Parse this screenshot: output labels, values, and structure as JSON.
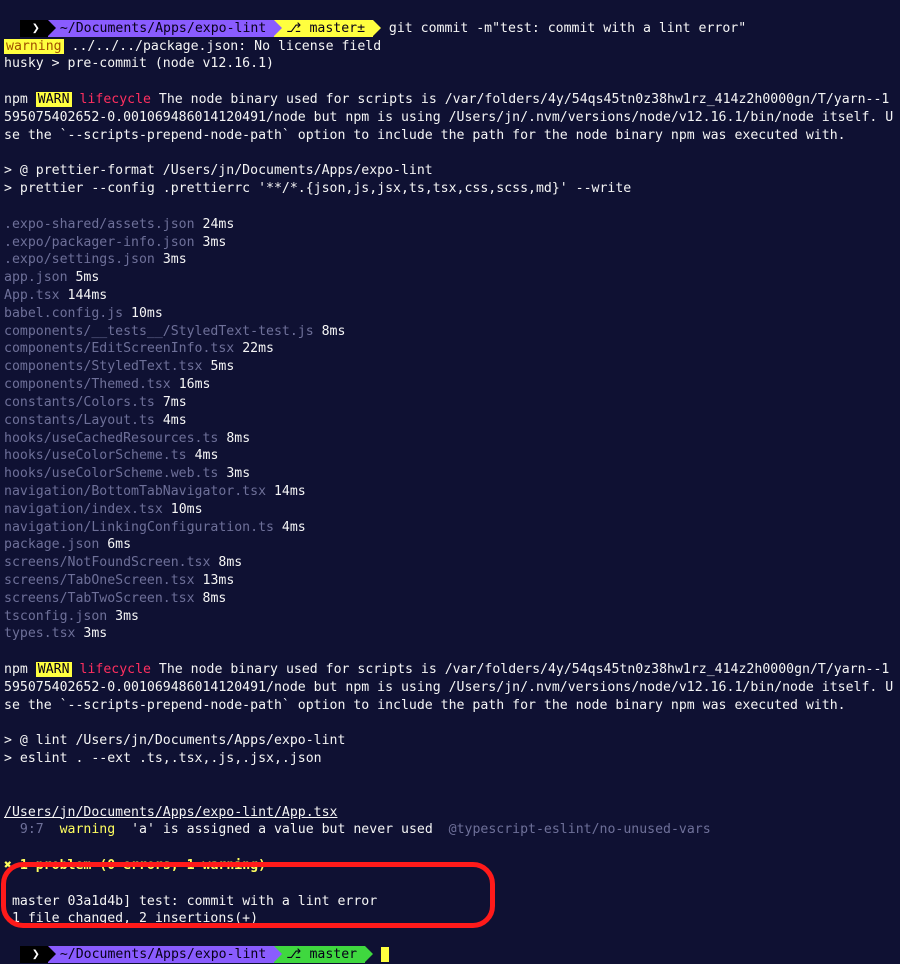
{
  "prompt1": {
    "chevron": "❯",
    "path": "~/Documents/Apps/expo-lint",
    "branch_icon": "⎇",
    "branch": "master±",
    "command": "git commit -m\"test: commit with a lint error\""
  },
  "warning_line": {
    "prefix": "warning",
    "text": " ../../../package.json: No license field"
  },
  "husky": "husky > pre-commit (node v12.16.1)",
  "npm_warn": {
    "npm": "npm",
    "warn": "WARN",
    "lifecycle": "lifecycle",
    "msg": " The node binary used for scripts is /var/folders/4y/54qs45tn0z38hw1rz_414z2h0000gn/T/yarn--1595075402652-0.001069486014120491/node but npm is using /Users/jn/.nvm/versions/node/v12.16.1/bin/node itself. Use the `--scripts-prepend-node-path` option to include the path for the node binary npm was executed with."
  },
  "prettier_hdr": "> @ prettier-format /Users/jn/Documents/Apps/expo-lint",
  "prettier_cmd": "> prettier --config .prettierrc '**/*.{json,js,jsx,ts,tsx,css,scss,md}' --write",
  "files": [
    {
      "name": ".expo-shared/assets.json",
      "time": "24ms"
    },
    {
      "name": ".expo/packager-info.json",
      "time": "3ms"
    },
    {
      "name": ".expo/settings.json",
      "time": "3ms"
    },
    {
      "name": "app.json",
      "time": "5ms"
    },
    {
      "name": "App.tsx",
      "time": "144ms"
    },
    {
      "name": "babel.config.js",
      "time": "10ms"
    },
    {
      "name": "components/__tests__/StyledText-test.js",
      "time": "8ms"
    },
    {
      "name": "components/EditScreenInfo.tsx",
      "time": "22ms"
    },
    {
      "name": "components/StyledText.tsx",
      "time": "5ms"
    },
    {
      "name": "components/Themed.tsx",
      "time": "16ms"
    },
    {
      "name": "constants/Colors.ts",
      "time": "7ms"
    },
    {
      "name": "constants/Layout.ts",
      "time": "4ms"
    },
    {
      "name": "hooks/useCachedResources.ts",
      "time": "8ms"
    },
    {
      "name": "hooks/useColorScheme.ts",
      "time": "4ms"
    },
    {
      "name": "hooks/useColorScheme.web.ts",
      "time": "3ms"
    },
    {
      "name": "navigation/BottomTabNavigator.tsx",
      "time": "14ms"
    },
    {
      "name": "navigation/index.tsx",
      "time": "10ms"
    },
    {
      "name": "navigation/LinkingConfiguration.ts",
      "time": "4ms"
    },
    {
      "name": "package.json",
      "time": "6ms"
    },
    {
      "name": "screens/NotFoundScreen.tsx",
      "time": "8ms"
    },
    {
      "name": "screens/TabOneScreen.tsx",
      "time": "13ms"
    },
    {
      "name": "screens/TabTwoScreen.tsx",
      "time": "8ms"
    },
    {
      "name": "tsconfig.json",
      "time": "3ms"
    },
    {
      "name": "types.tsx",
      "time": "3ms"
    }
  ],
  "lint_hdr": "> @ lint /Users/jn/Documents/Apps/expo-lint",
  "lint_cmd": "> eslint . --ext .ts,.tsx,.js,.jsx,.json",
  "lint_file": "/Users/jn/Documents/Apps/expo-lint/App.tsx",
  "lint_entry": {
    "loc": "  9:7",
    "level": "warning",
    "msg": "'a' is assigned a value but never used",
    "rule": "@typescript-eslint/no-unused-vars"
  },
  "problem_mark": "✖",
  "problem_summary": " 1 problem (0 errors, 1 warning)",
  "commit_line1": "master 03a1d4b] test: commit with a lint error",
  "commit_line2": " 1 file changed, 2 insertions(+)",
  "prompt2": {
    "chevron": "❯",
    "path": "~/Documents/Apps/expo-lint",
    "branch_icon": "⎇",
    "branch": "master"
  }
}
